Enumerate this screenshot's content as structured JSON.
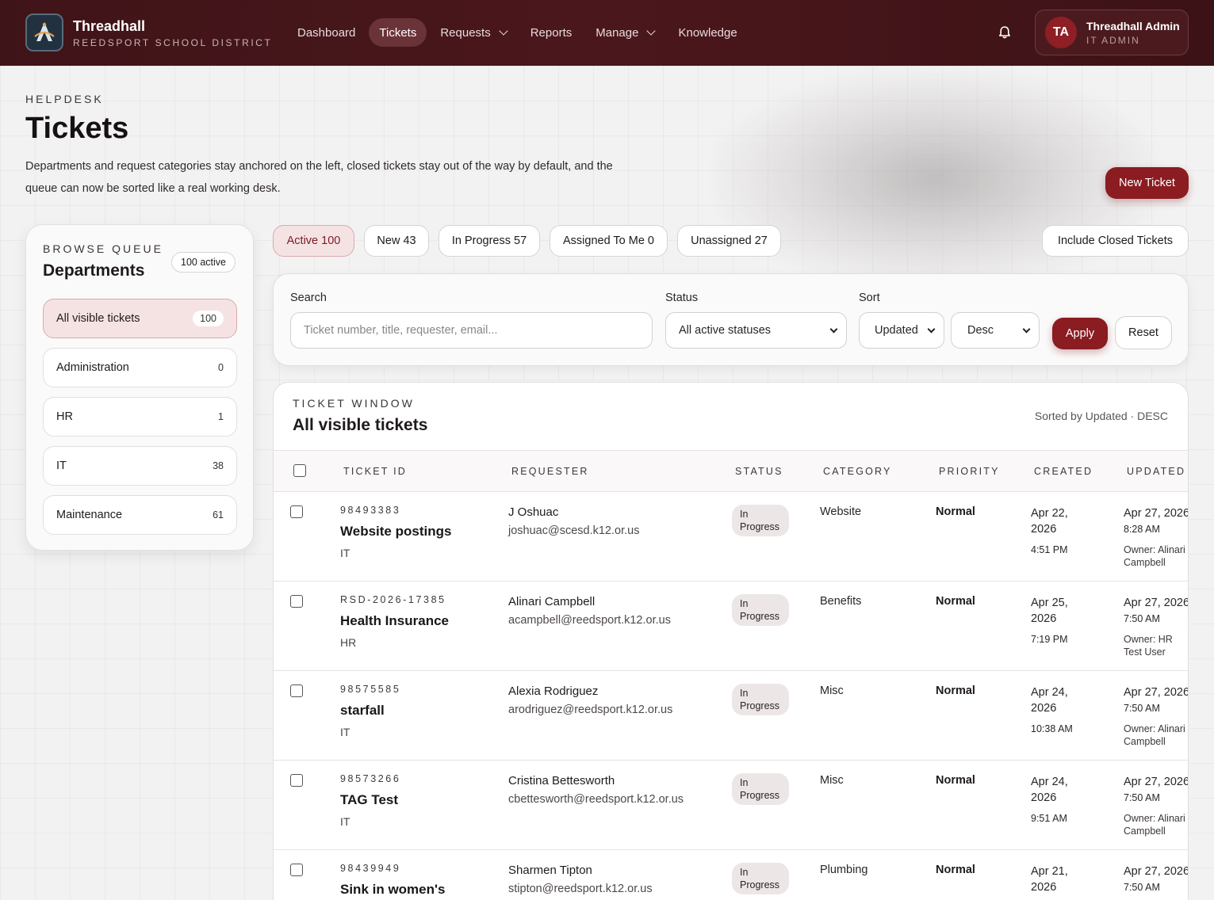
{
  "brand": {
    "name": "Threadhall",
    "subtitle": "REEDSPORT SCHOOL DISTRICT"
  },
  "nav": [
    {
      "label": "Dashboard",
      "active": false,
      "dropdown": false
    },
    {
      "label": "Tickets",
      "active": true,
      "dropdown": false
    },
    {
      "label": "Requests",
      "active": false,
      "dropdown": true
    },
    {
      "label": "Reports",
      "active": false,
      "dropdown": false
    },
    {
      "label": "Manage",
      "active": false,
      "dropdown": true
    },
    {
      "label": "Knowledge",
      "active": false,
      "dropdown": false
    }
  ],
  "user": {
    "initials": "TA",
    "name": "Threadhall Admin",
    "role": "IT ADMIN"
  },
  "header": {
    "eyebrow": "HELPDESK",
    "title": "Tickets",
    "description": "Departments and request categories stay anchored on the left, closed tickets stay out of the way by default, and the queue can now be sorted like a real working desk.",
    "new_ticket_label": "New Ticket"
  },
  "sidebar": {
    "eyebrow": "BROWSE QUEUE",
    "title": "Departments",
    "badge": "100 active",
    "items": [
      {
        "label": "All visible tickets",
        "count": "100",
        "active": true
      },
      {
        "label": "Administration",
        "count": "0",
        "active": false
      },
      {
        "label": "HR",
        "count": "1",
        "active": false
      },
      {
        "label": "IT",
        "count": "38",
        "active": false
      },
      {
        "label": "Maintenance",
        "count": "61",
        "active": false
      }
    ]
  },
  "chips": [
    {
      "label": "Active 100",
      "active": true
    },
    {
      "label": "New 43",
      "active": false
    },
    {
      "label": "In Progress 57",
      "active": false
    },
    {
      "label": "Assigned To Me 0",
      "active": false
    },
    {
      "label": "Unassigned 27",
      "active": false
    }
  ],
  "include_closed_label": "Include Closed Tickets",
  "filters": {
    "search_label": "Search",
    "search_placeholder": "Ticket number, title, requester, email...",
    "status_label": "Status",
    "status_value": "All active statuses",
    "sort_label": "Sort",
    "sort_field": "Updated",
    "sort_dir": "Desc",
    "apply_label": "Apply",
    "reset_label": "Reset"
  },
  "table": {
    "eyebrow": "TICKET WINDOW",
    "title": "All visible tickets",
    "sort_info": "Sorted by Updated · DESC",
    "columns": [
      "TICKET ID",
      "REQUESTER",
      "STATUS",
      "CATEGORY",
      "PRIORITY",
      "CREATED",
      "UPDATED"
    ],
    "rows": [
      {
        "id": "98493383",
        "title": "Website postings",
        "dept": "IT",
        "requester": "J Oshuac",
        "email": "joshuac@scesd.k12.or.us",
        "status": "In Progress",
        "category": "Website",
        "priority": "Normal",
        "created_date": "Apr 22, 2026",
        "created_time": "4:51 PM",
        "updated_date": "Apr 27, 2026",
        "updated_time": "8:28 AM",
        "owner": "Owner: Alinari Campbell"
      },
      {
        "id": "RSD-2026-17385",
        "title": "Health Insurance",
        "dept": "HR",
        "requester": "Alinari Campbell",
        "email": "acampbell@reedsport.k12.or.us",
        "status": "In Progress",
        "category": "Benefits",
        "priority": "Normal",
        "created_date": "Apr 25, 2026",
        "created_time": "7:19 PM",
        "updated_date": "Apr 27, 2026",
        "updated_time": "7:50 AM",
        "owner": "Owner: HR Test User"
      },
      {
        "id": "98575585",
        "title": "starfall",
        "dept": "IT",
        "requester": "Alexia Rodriguez",
        "email": "arodriguez@reedsport.k12.or.us",
        "status": "In Progress",
        "category": "Misc",
        "priority": "Normal",
        "created_date": "Apr 24, 2026",
        "created_time": "10:38 AM",
        "updated_date": "Apr 27, 2026",
        "updated_time": "7:50 AM",
        "owner": "Owner: Alinari Campbell"
      },
      {
        "id": "98573266",
        "title": "TAG Test",
        "dept": "IT",
        "requester": "Cristina Bettesworth",
        "email": "cbettesworth@reedsport.k12.or.us",
        "status": "In Progress",
        "category": "Misc",
        "priority": "Normal",
        "created_date": "Apr 24, 2026",
        "created_time": "9:51 AM",
        "updated_date": "Apr 27, 2026",
        "updated_time": "7:50 AM",
        "owner": "Owner: Alinari Campbell"
      },
      {
        "id": "98439949",
        "title": "Sink in women's",
        "dept": "",
        "requester": "Sharmen Tipton",
        "email": "stipton@reedsport.k12.or.us",
        "status": "In Progress",
        "category": "Plumbing",
        "priority": "Normal",
        "created_date": "Apr 21, 2026",
        "created_time": "",
        "updated_date": "Apr 27, 2026",
        "updated_time": "7:50 AM",
        "owner": ""
      }
    ]
  },
  "icons": {
    "logo": "threadhall-logo",
    "bell": "bell-icon"
  },
  "colors": {
    "brand_dark": "#3f1418",
    "accent": "#8a1c22",
    "accent_soft": "#f5e3e4"
  }
}
